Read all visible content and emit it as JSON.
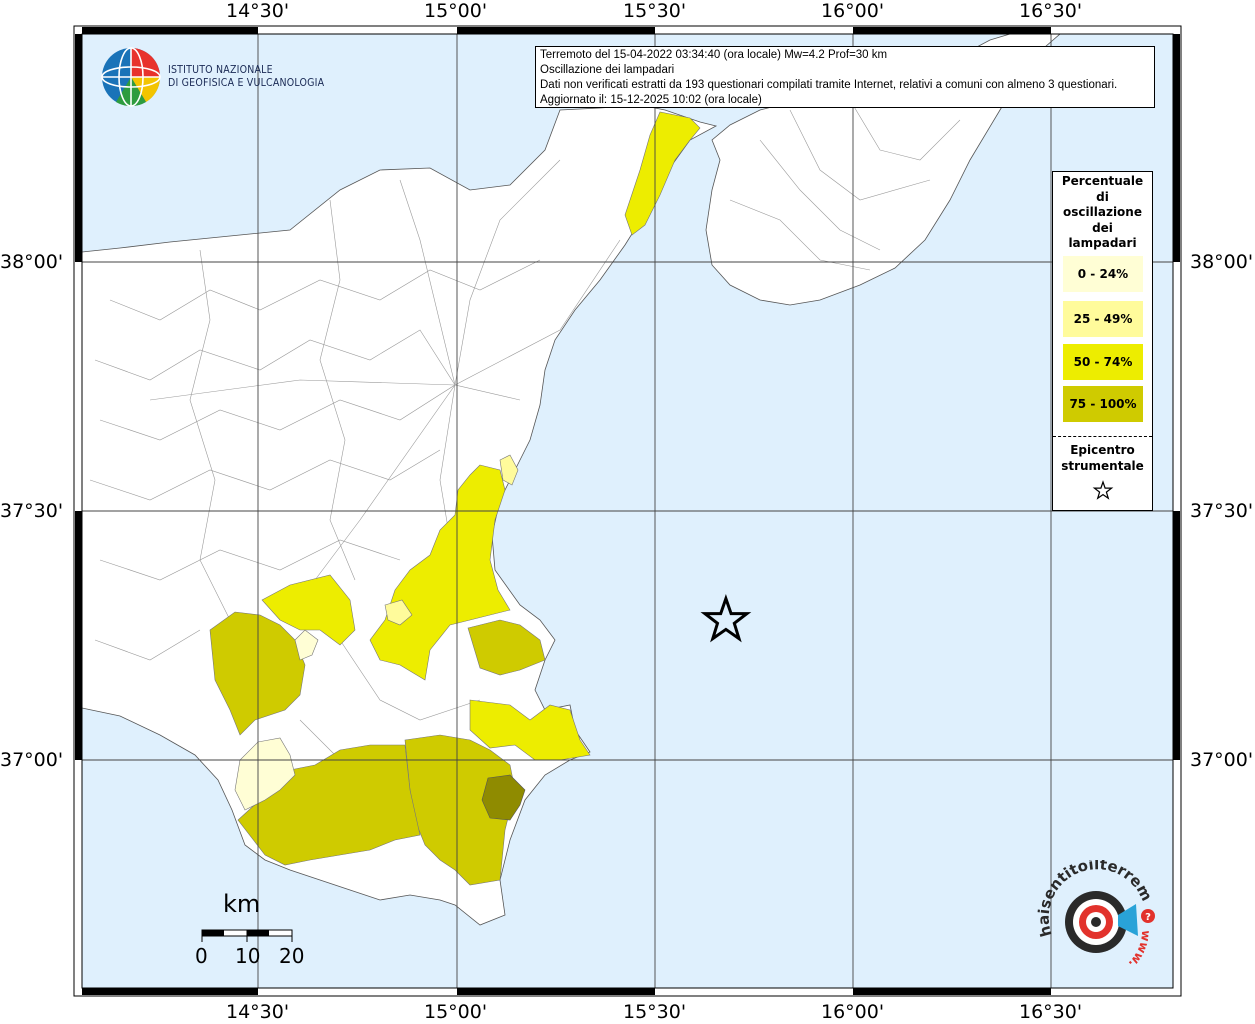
{
  "header": {
    "line1": "Terremoto del 15-04-2022 03:34:40 (ora locale) Mw=4.2 Prof=30 km",
    "line2": "Oscillazione dei lampadari",
    "line3": "Dati non verificati estratti da 193 questionari compilati tramite Internet, relativi a comuni con almeno 3 questionari.",
    "line4": "Aggiornato il: 15-12-2025 10:02 (ora locale)"
  },
  "logo": {
    "org_line1": "ISTITUTO NAZIONALE",
    "org_line2": "DI GEOFISICA E VULCANOLOGIA",
    "site_name": "haisentitoilterremoto.it",
    "site_prefix": "www.",
    "site_icon": "question-mark-icon"
  },
  "axes": {
    "top_labels": [
      "14°30'",
      "15°00'",
      "15°30'",
      "16°00'",
      "16°30'"
    ],
    "bottom_labels": [
      "14°30'",
      "15°00'",
      "15°30'",
      "16°00'",
      "16°30'"
    ],
    "left_labels": [
      "38°00'",
      "37°30'",
      "37°00'"
    ],
    "right_labels": [
      "38°00'",
      "37°30'",
      "37°00'"
    ]
  },
  "legend": {
    "title_lines": [
      "Percentuale",
      "di",
      "oscillazione",
      "dei",
      "lampadari"
    ],
    "classes": [
      {
        "label": "0 - 24%",
        "color": "#fffed5"
      },
      {
        "label": "25 - 49%",
        "color": "#fffb9b"
      },
      {
        "label": "50 - 74%",
        "color": "#eded00"
      },
      {
        "label": "75 - 100%",
        "color": "#cfcb00"
      }
    ],
    "epicenter_lines": [
      "Epicentro",
      "strumentale"
    ],
    "epicenter_icon": "star-icon"
  },
  "scale_bar": {
    "unit": "km",
    "ticks": [
      "0",
      "10",
      "20"
    ]
  },
  "colors": {
    "sea": "#dff0fd",
    "land": "#ffffff",
    "class_darkest": "#8f8b00"
  },
  "epicenter": {
    "lon": 15.68,
    "lat": 37.28
  }
}
